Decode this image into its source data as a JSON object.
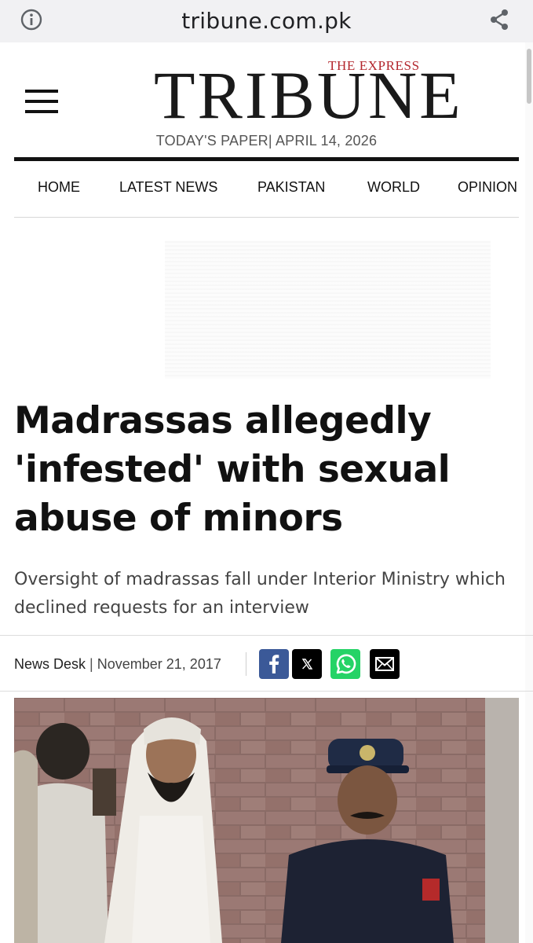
{
  "browser": {
    "domain": "tribune.com.pk",
    "icons": {
      "info": "info-icon",
      "share": "share-icon"
    }
  },
  "header": {
    "logo_small": "THE EXPRESS",
    "logo_main": "TRIBUNE",
    "paper_date": "TODAY'S PAPER| APRIL 14, 2026",
    "menu_icon": "hamburger-menu-icon"
  },
  "nav": {
    "items": [
      {
        "label": "HOME"
      },
      {
        "label": "LATEST NEWS"
      },
      {
        "label": "PAKISTAN"
      },
      {
        "label": "WORLD"
      },
      {
        "label": "OPINION"
      }
    ]
  },
  "article": {
    "headline": "Madrassas allegedly 'infested' with sexual abuse of minors",
    "subhead": "Oversight of madrassas fall under Interior Ministry which declined requests for an interview",
    "author": "News Desk",
    "separator": "|",
    "date": "November 21, 2017",
    "share_icons": [
      "facebook-icon",
      "x-icon",
      "whatsapp-icon",
      "email-icon"
    ]
  },
  "colors": {
    "logo_accent": "#b3272d",
    "facebook": "#3b5998",
    "x": "#000000",
    "whatsapp": "#25d366",
    "email": "#000000"
  }
}
